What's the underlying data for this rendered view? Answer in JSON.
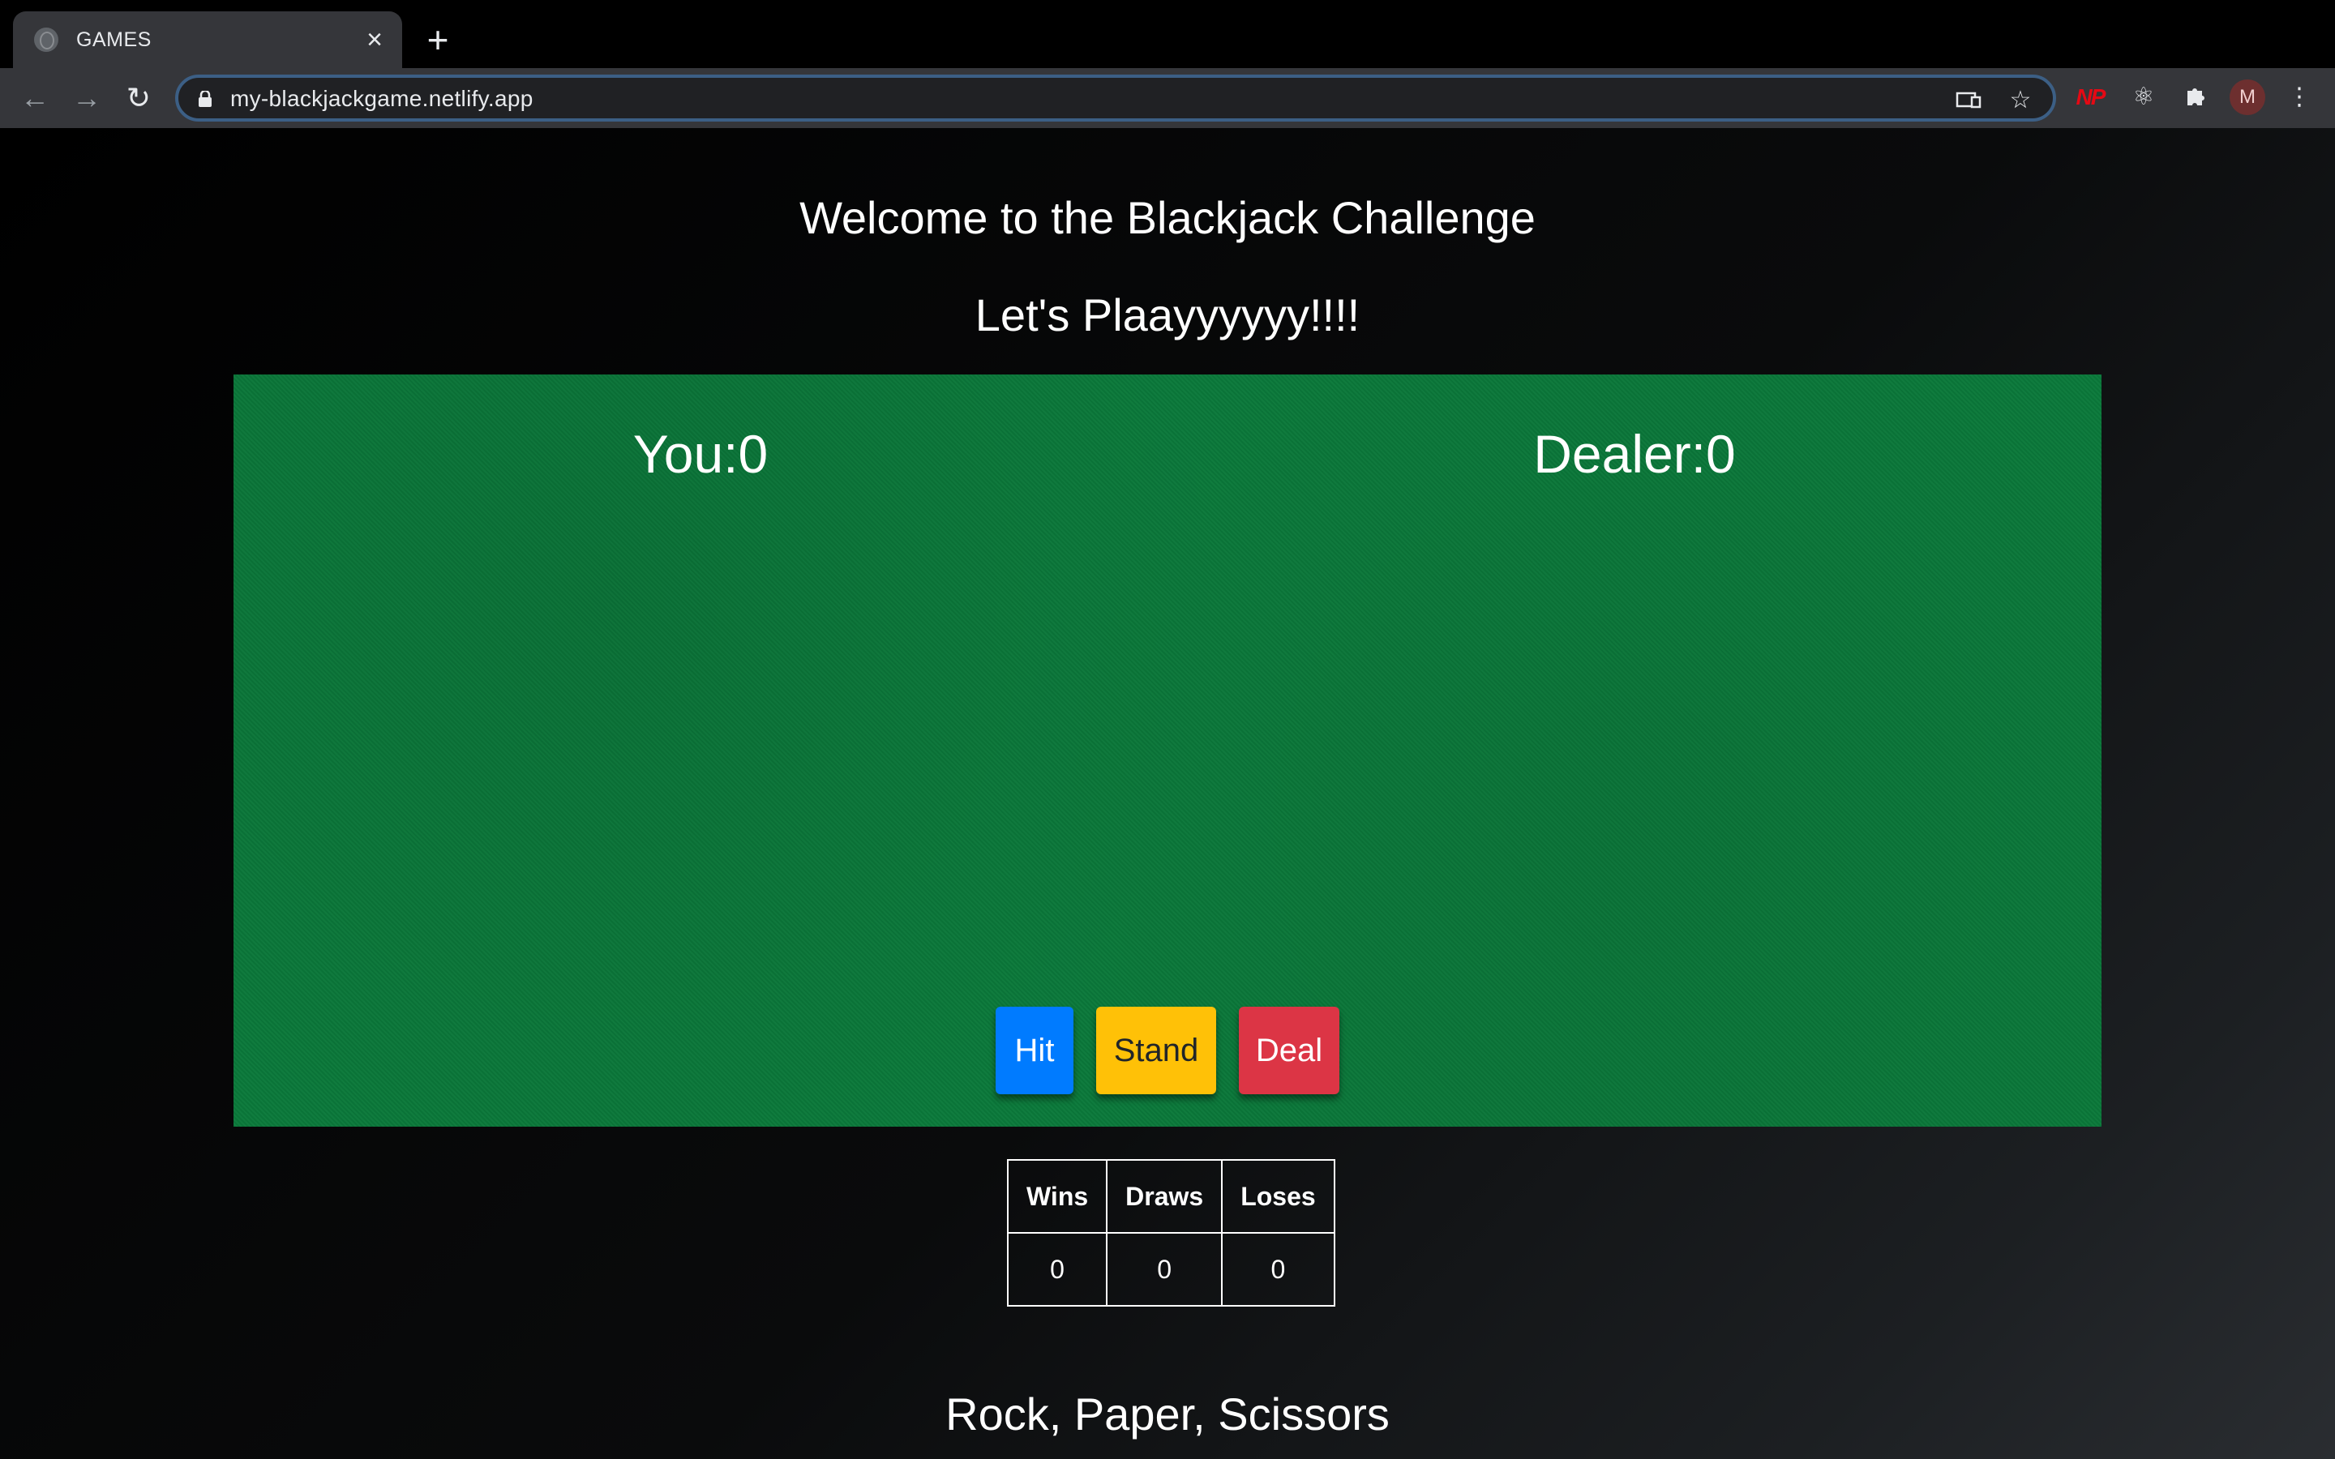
{
  "browser": {
    "tab_title": "GAMES",
    "url": "my-blackjackgame.netlify.app",
    "avatar_initial": "M",
    "extension_np_label": "NP"
  },
  "page": {
    "welcome_heading": "Welcome to the Blackjack Challenge",
    "play_heading": "Let's Plaayyyyyy!!!!",
    "player_score": "You:0",
    "dealer_score": "Dealer:0",
    "buttons": {
      "hit": "Hit",
      "stand": "Stand",
      "deal": "Deal"
    },
    "results_table": {
      "headers": [
        "Wins",
        "Draws",
        "Loses"
      ],
      "values": [
        "0",
        "0",
        "0"
      ]
    },
    "rps_heading": "Rock, Paper, Scissors"
  },
  "colors": {
    "felt": "#0b7a3b",
    "hit": "#007bff",
    "stand": "#ffc107",
    "deal": "#dc3545"
  }
}
